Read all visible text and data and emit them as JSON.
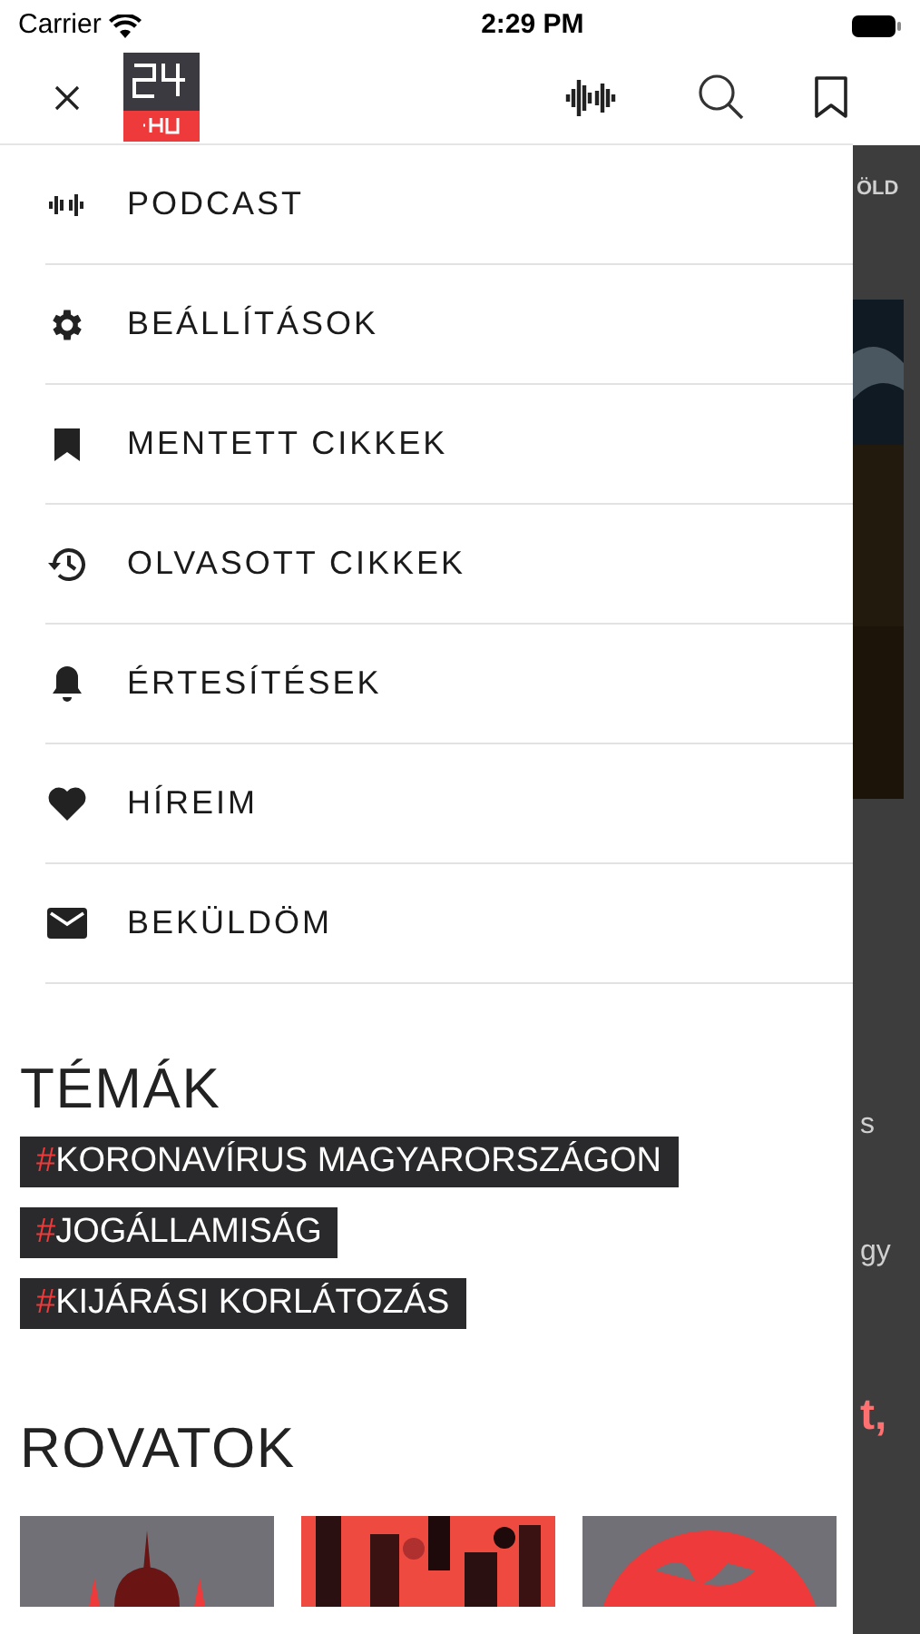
{
  "status_bar": {
    "carrier": "Carrier",
    "time": "2:29 PM"
  },
  "menu": [
    {
      "label": "PODCAST"
    },
    {
      "label": "BEÁLLÍTÁSOK"
    },
    {
      "label": "MENTETT CIKKEK"
    },
    {
      "label": "OLVASOTT CIKKEK"
    },
    {
      "label": "ÉRTESÍTÉSEK"
    },
    {
      "label": "HÍREIM"
    },
    {
      "label": "BEKÜLDÖM"
    }
  ],
  "topics": {
    "title": "TÉMÁK",
    "tags": [
      {
        "hash": "#",
        "label": "KORONAVÍRUS MAGYARORSZÁGON"
      },
      {
        "hash": "#",
        "label": "JOGÁLLAMISÁG"
      },
      {
        "hash": "#",
        "label": "KIJÁRÁSI KORLÁTOZÁS"
      }
    ]
  },
  "sections": {
    "title": "ROVATOK"
  },
  "background": {
    "tab": "ÖLD",
    "text_1": "s",
    "text_2": "gy",
    "headline": "t,"
  }
}
